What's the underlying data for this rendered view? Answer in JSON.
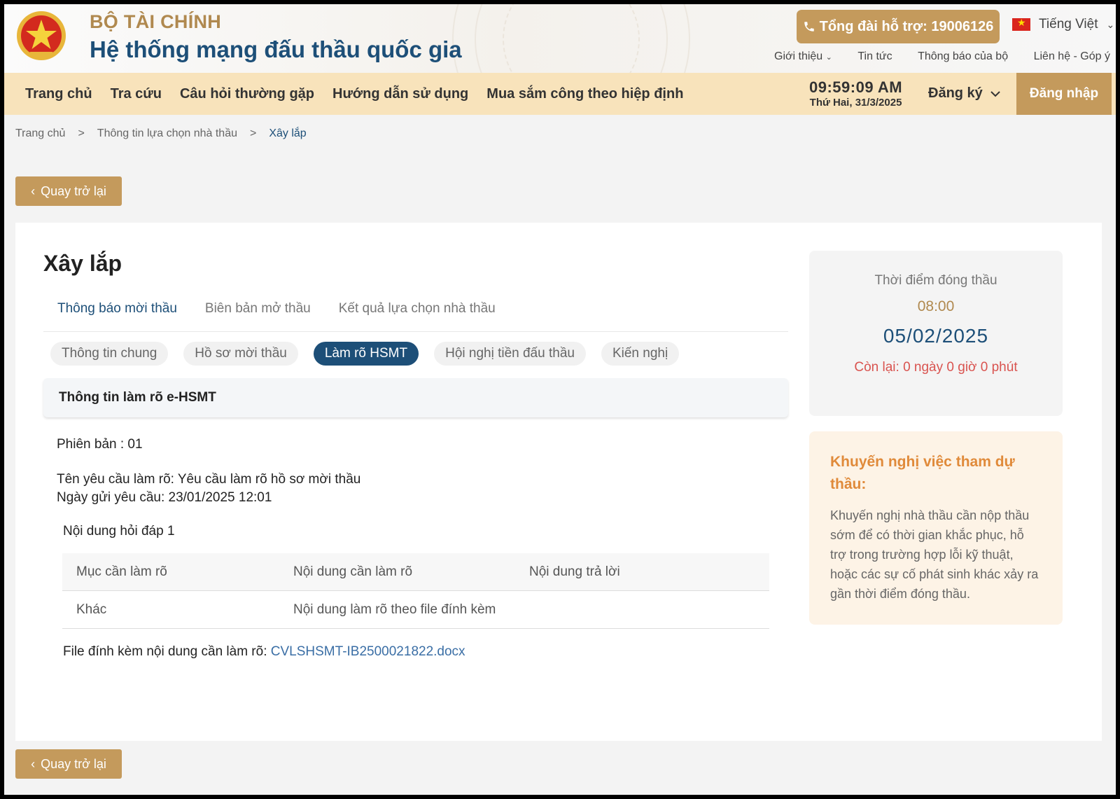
{
  "header": {
    "ministry": "BỘ TÀI CHÍNH",
    "system_name": "Hệ thống mạng đấu thầu quốc gia",
    "hotline": "Tổng đài hỗ trợ: 19006126",
    "language": "Tiếng Việt",
    "top_links": [
      "Giới thiệu",
      "Tin tức",
      "Thông báo của bộ",
      "Liên hệ - Góp ý"
    ]
  },
  "nav": {
    "items": [
      "Trang chủ",
      "Tra cứu",
      "Câu hỏi thường gặp",
      "Hướng dẫn sử dụng",
      "Mua sắm công theo hiệp định"
    ],
    "time": "09:59:09 AM",
    "date": "Thứ Hai, 31/3/2025",
    "register": "Đăng ký",
    "login": "Đăng nhập"
  },
  "breadcrumb": [
    "Trang chủ",
    "Thông tin lựa chọn nhà thầu",
    "Xây lắp"
  ],
  "back_label": "Quay trở lại",
  "main": {
    "title": "Xây lắp",
    "tabs": [
      "Thông báo mời thầu",
      "Biên bản mở thầu",
      "Kết quả lựa chọn nhà thầu"
    ],
    "pills": [
      "Thông tin chung",
      "Hồ sơ mời thầu",
      "Làm rõ HSMT",
      "Hội nghị tiền đấu thầu",
      "Kiến nghị"
    ],
    "section_title": "Thông tin làm rõ e-HSMT",
    "version": "Phiên bản : 01",
    "request_name": "Tên yêu cầu làm rõ: Yêu cầu làm rõ hồ sơ mời thầu",
    "request_date": "Ngày gửi yêu cầu: 23/01/2025 12:01",
    "qa_title": "Nội dung hỏi đáp 1",
    "table": {
      "headers": [
        "Mục cần làm rõ",
        "Nội dung cần làm rõ",
        "Nội dung trả lời"
      ],
      "rows": [
        [
          "Khác",
          "Nội dung làm rõ theo file đính kèm",
          ""
        ]
      ]
    },
    "file_label": "File đính kèm nội dung cần làm rõ:",
    "file_name": "CVLSHSMT-IB2500021822.docx"
  },
  "closing": {
    "label": "Thời điểm đóng thầu",
    "time": "08:00",
    "date": "05/02/2025",
    "remaining": "Còn lại: 0 ngày 0 giờ 0 phút"
  },
  "advice": {
    "title": "Khuyến nghị việc tham dự thầu:",
    "text": "Khuyến nghị nhà thầu cần nộp thầu sớm để có thời gian khắc phục, hỗ trợ trong trường hợp lỗi kỹ thuật, hoặc các sự cố phát sinh khác xảy ra gần thời điểm đóng thầu."
  },
  "colors": {
    "gold": "#c49a5c",
    "navy": "#1d4f78",
    "nav_bg": "#f8e3bb",
    "warning": "#d9534f",
    "advice_title": "#e08a3a"
  },
  "icons": [
    "national-emblem-icon",
    "phone-icon",
    "vietnam-flag-icon",
    "chevron-down-icon",
    "chevron-left-icon"
  ]
}
